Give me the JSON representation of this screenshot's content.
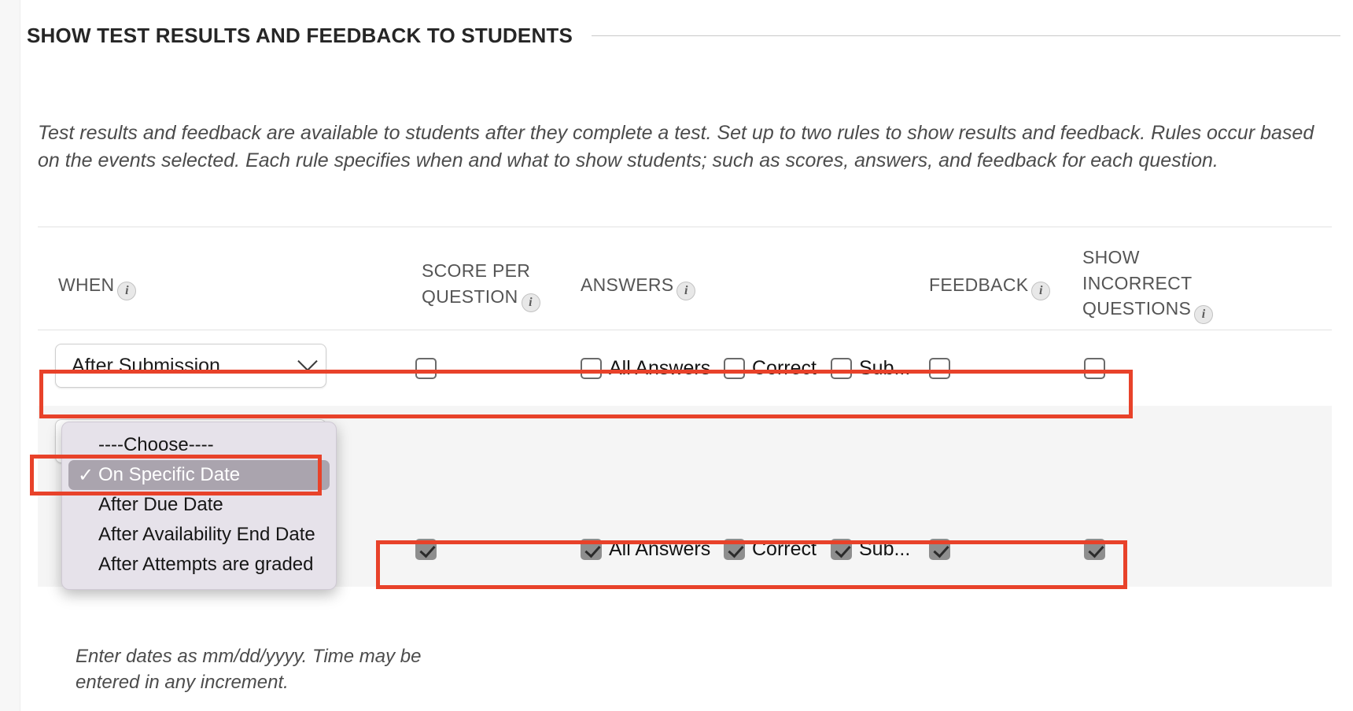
{
  "section": {
    "title": "SHOW TEST RESULTS AND FEEDBACK TO STUDENTS",
    "intro": "Test results and feedback are available to students after they complete a test. Set up to two rules to show results and feedback. Rules occur based on the events selected. Each rule specifies when and what to show students; such as scores, answers, and feedback for each question."
  },
  "table": {
    "headers": {
      "when": "WHEN",
      "score_per_question": "SCORE PER QUESTION",
      "answers": "ANSWERS",
      "feedback": "FEEDBACK",
      "show_incorrect_questions": "SHOW INCORRECT QUESTIONS"
    },
    "info_icon": "i"
  },
  "rows": [
    {
      "when_value": "After Submission",
      "score_per_question_checked": false,
      "answers": [
        {
          "label": "All Answers",
          "checked": false
        },
        {
          "label": "Correct",
          "checked": false
        },
        {
          "label": "Sub...",
          "checked": false
        }
      ],
      "feedback_checked": false,
      "show_incorrect_checked": false
    },
    {
      "when_value": "",
      "score_per_question_checked": true,
      "answers": [
        {
          "label": "All Answers",
          "checked": true
        },
        {
          "label": "Correct",
          "checked": true
        },
        {
          "label": "Sub...",
          "checked": true
        }
      ],
      "feedback_checked": true,
      "show_incorrect_checked": true
    }
  ],
  "dropdown": {
    "options": [
      {
        "label": "----Choose----",
        "selected": false
      },
      {
        "label": "On Specific Date",
        "selected": true
      },
      {
        "label": "After Due Date",
        "selected": false
      },
      {
        "label": "After Availability End Date",
        "selected": false
      },
      {
        "label": "After Attempts are graded",
        "selected": false
      }
    ],
    "check_glyph": "✓"
  },
  "note": "Enter dates as mm/dd/yyyy. Time may be entered in any increment.",
  "colors": {
    "highlight": "#e8422a",
    "selected_option_bg": "#aaa4ae",
    "popup_bg": "#e6e2ea",
    "alt_row_bg": "#f5f5f5"
  }
}
